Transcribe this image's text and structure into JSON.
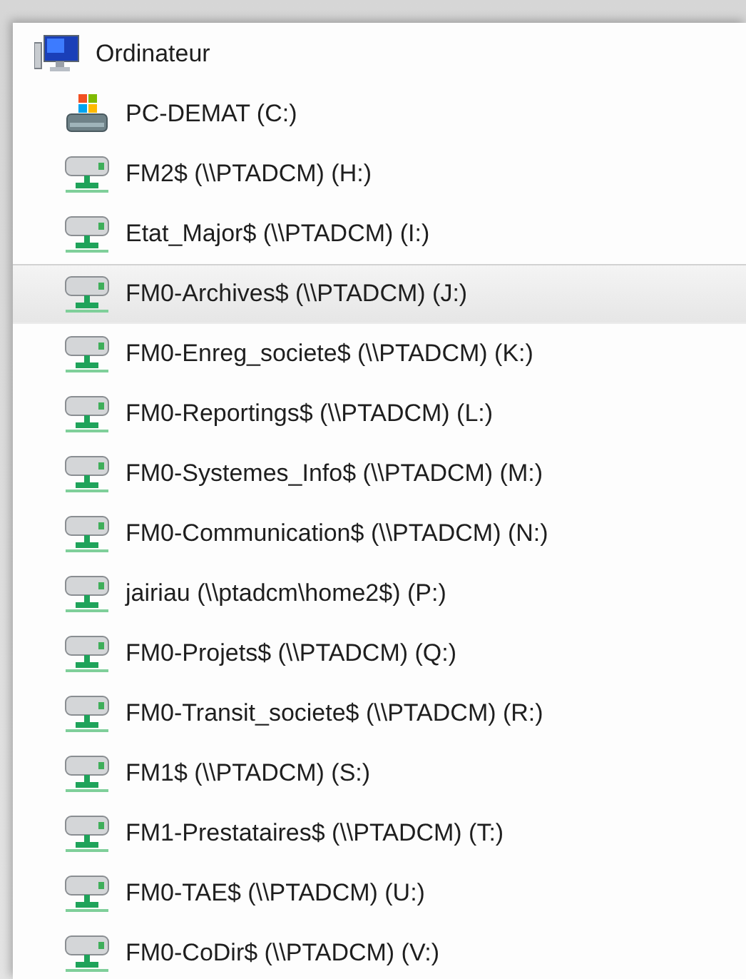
{
  "tree": {
    "label": "Ordinateur",
    "selected": false,
    "children": [
      {
        "kind": "system_drive",
        "label": "PC-DEMAT (C:)",
        "selected": false
      },
      {
        "kind": "network_drive",
        "label": "FM2$ (\\\\PTADCM) (H:)",
        "selected": false
      },
      {
        "kind": "network_drive",
        "label": "Etat_Major$ (\\\\PTADCM) (I:)",
        "selected": false
      },
      {
        "kind": "network_drive",
        "label": "FM0-Archives$ (\\\\PTADCM) (J:)",
        "selected": true
      },
      {
        "kind": "network_drive",
        "label": "FM0-Enreg_societe$ (\\\\PTADCM) (K:)",
        "selected": false
      },
      {
        "kind": "network_drive",
        "label": "FM0-Reportings$ (\\\\PTADCM) (L:)",
        "selected": false
      },
      {
        "kind": "network_drive",
        "label": "FM0-Systemes_Info$ (\\\\PTADCM) (M:)",
        "selected": false
      },
      {
        "kind": "network_drive",
        "label": "FM0-Communication$ (\\\\PTADCM) (N:)",
        "selected": false
      },
      {
        "kind": "network_drive",
        "label": "jairiau (\\\\ptadcm\\home2$) (P:)",
        "selected": false
      },
      {
        "kind": "network_drive",
        "label": "FM0-Projets$ (\\\\PTADCM) (Q:)",
        "selected": false
      },
      {
        "kind": "network_drive",
        "label": "FM0-Transit_societe$ (\\\\PTADCM) (R:)",
        "selected": false
      },
      {
        "kind": "network_drive",
        "label": "FM1$ (\\\\PTADCM) (S:)",
        "selected": false
      },
      {
        "kind": "network_drive",
        "label": "FM1-Prestataires$ (\\\\PTADCM) (T:)",
        "selected": false
      },
      {
        "kind": "network_drive",
        "label": "FM0-TAE$ (\\\\PTADCM) (U:)",
        "selected": false
      },
      {
        "kind": "network_drive",
        "label": "FM0-CoDir$ (\\\\PTADCM) (V:)",
        "selected": false
      }
    ]
  }
}
